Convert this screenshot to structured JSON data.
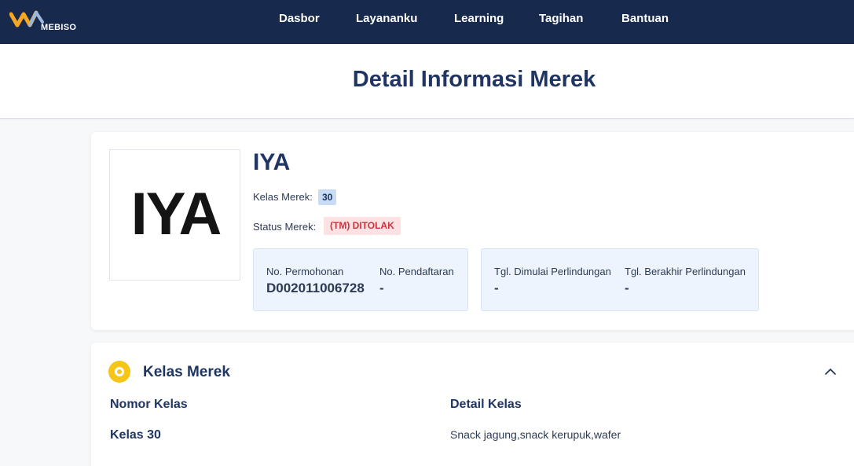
{
  "navbar": {
    "logo_text": "MEBISO",
    "items": [
      {
        "label": "Dasbor"
      },
      {
        "label": "Layananku"
      },
      {
        "label": "Learning"
      },
      {
        "label": "Tagihan"
      },
      {
        "label": "Bantuan"
      }
    ],
    "colors": {
      "background": "#172a4e",
      "text": "#ffffff",
      "logo_accent": "#f5a623",
      "logo_secondary": "#9bb7e0"
    }
  },
  "page": {
    "title": "Detail Informasi Merek"
  },
  "brand": {
    "logo_word": "IYA",
    "name": "IYA",
    "class_label": "Kelas Merek:",
    "class_value": "30",
    "status_label": "Status Merek:",
    "status_value": "(TM) DITOLAK",
    "status_color": "#d0313c",
    "info_left": {
      "application_no_label": "No. Permohonan",
      "application_no_value": "D002011006728",
      "registration_no_label": "No. Pendaftaran",
      "registration_no_value": "-"
    },
    "info_right": {
      "protection_start_label": "Tgl. Dimulai Perlindungan",
      "protection_start_value": "-",
      "protection_end_label": "Tgl. Berakhir Perlindungan",
      "protection_end_value": "-"
    }
  },
  "class_section": {
    "title": "Kelas Merek",
    "icon": "coin-icon",
    "collapse_icon": "chevron-up-icon",
    "columns": [
      "Nomor Kelas",
      "Detail Kelas"
    ],
    "rows": [
      {
        "class_no": "Kelas 30",
        "detail": "Snack jagung,snack kerupuk,wafer"
      }
    ]
  }
}
